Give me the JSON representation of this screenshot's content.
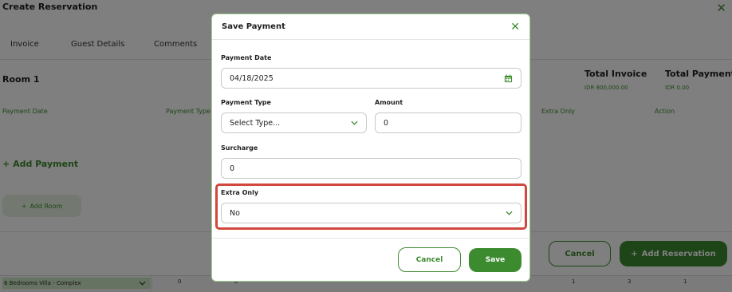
{
  "background": {
    "title": "Create Reservation",
    "tabs": [
      "Invoice",
      "Guest Details",
      "Comments"
    ],
    "room_label": "Room 1",
    "total_invoice_label": "Total Invoice",
    "total_invoice_value": "IDR 800,000.00",
    "total_payment_label": "Total Payment",
    "total_payment_value": "IDR 0.00",
    "columns": [
      "Payment Date",
      "Payment Type",
      "Extra Only",
      "Action"
    ],
    "add_payment_label": "Add Payment",
    "add_room_label": "Add Room",
    "cancel_label": "Cancel",
    "add_reservation_label": "Add Reservation",
    "grid_row_label": "6 Bedrooms Villa - Complex",
    "grid_numbers": [
      "0",
      "0",
      "1",
      "1",
      "3",
      "1"
    ]
  },
  "modal": {
    "title": "Save Payment",
    "payment_date_label": "Payment Date",
    "payment_date_value": "04/18/2025",
    "payment_type_label": "Payment Type",
    "payment_type_value": "Select Type...",
    "amount_label": "Amount",
    "amount_value": "0",
    "surcharge_label": "Surcharge",
    "surcharge_value": "0",
    "extra_only_label": "Extra Only",
    "extra_only_value": "No",
    "cancel_label": "Cancel",
    "save_label": "Save"
  },
  "colors": {
    "accent": "#3d8b2f",
    "highlight": "#d0483f"
  },
  "icons": [
    "close-icon",
    "calendar-icon",
    "chevron-down-icon",
    "plus-icon"
  ]
}
